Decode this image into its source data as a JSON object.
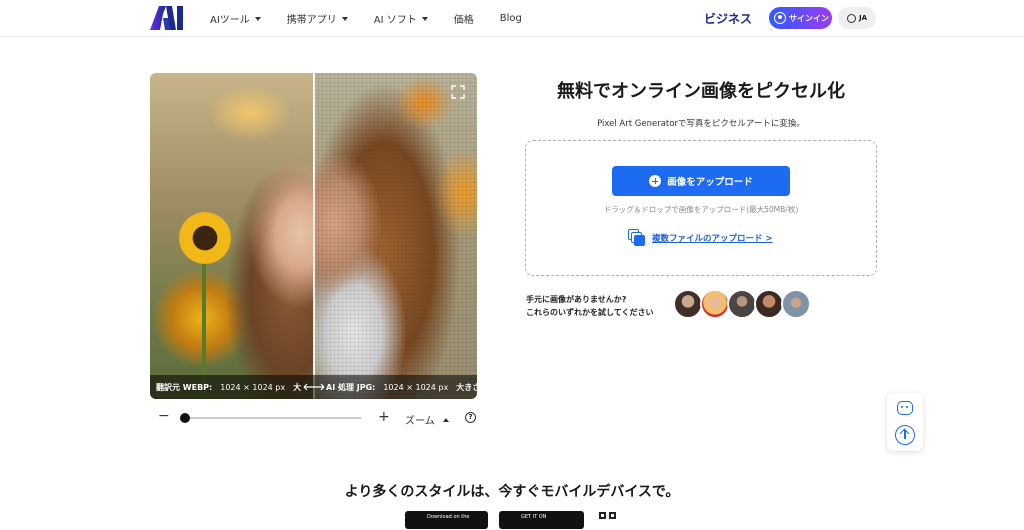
{
  "header": {
    "nav": [
      {
        "label": "AIツール",
        "has_caret": true
      },
      {
        "label": "携帯アプリ",
        "has_caret": true
      },
      {
        "label": "AI ソフト",
        "has_caret": true
      },
      {
        "label": "価格",
        "has_caret": false
      },
      {
        "label": "Blog",
        "has_caret": false
      }
    ],
    "business_label": "ビジネス",
    "signin_label": "サインイン",
    "lang_label": "JA"
  },
  "compare": {
    "original_label": "翻訳元 WEBP:",
    "original_info": "1024 × 1024 px",
    "original_trunc": "大",
    "result_label": "AI 処理 JPG:",
    "result_info": "1024 × 1024 px",
    "result_trunc": "大きさ"
  },
  "zoom": {
    "minus": "−",
    "plus": "+",
    "label": "ズーム",
    "help": "?",
    "level": 0.0
  },
  "main": {
    "title": "無料でオンライン画像をピクセル化",
    "subtitle": "Pixel Art Generatorで写真をピクセルアートに変換。",
    "upload_button": "画像をアップロード",
    "drop_hint": "ドラッグ＆ドロップで画像をアップロード(最大50MB/枚)",
    "multi_upload": "複数ファイルのアップロード >",
    "try_line1": "手元に画像がありませんか?",
    "try_line2": "これらのいずれかを試してください"
  },
  "samples": [
    {
      "color": "#6f5a4a"
    },
    {
      "color": "#d99a6a"
    },
    {
      "color": "#5a5550"
    },
    {
      "color": "#8a6a55"
    },
    {
      "color": "#9aa7b4"
    }
  ],
  "bottom": {
    "mobile_title": "より多くのスタイルは、今すぐモバイルデバイスで。",
    "app_store": "Download on the",
    "google_play": "GET IT ON"
  }
}
